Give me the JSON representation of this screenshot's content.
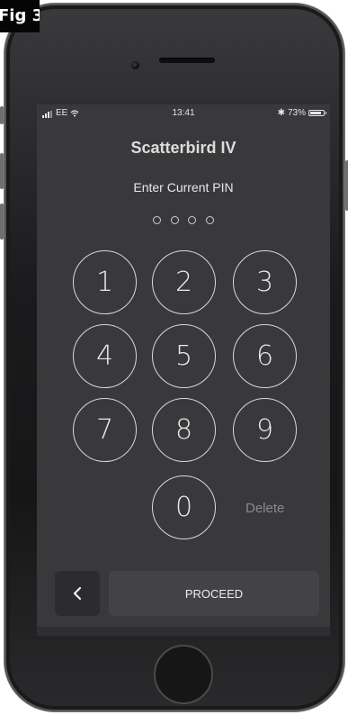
{
  "figure": {
    "label": "Fig 3"
  },
  "status_bar": {
    "carrier": "EE",
    "time": "13:41",
    "battery_text": "73%",
    "battery_level": 0.73,
    "icons": [
      "signal-bars-icon",
      "wifi-icon",
      "bluetooth-icon",
      "battery-icon"
    ]
  },
  "app": {
    "title": "Scatterbird IV"
  },
  "pin": {
    "prompt": "Enter Current PIN",
    "digits_entered": 0,
    "digits_total": 4
  },
  "keypad": {
    "keys": [
      "1",
      "2",
      "3",
      "4",
      "5",
      "6",
      "7",
      "8",
      "9",
      "0"
    ],
    "delete_label": "Delete"
  },
  "actions": {
    "back_icon": "chevron-left-icon",
    "proceed_label": "PROCEED"
  },
  "colors": {
    "screen_bg": "#39393c",
    "key_outline": "#d8d8d8",
    "delete_text": "#8a8a8c"
  }
}
